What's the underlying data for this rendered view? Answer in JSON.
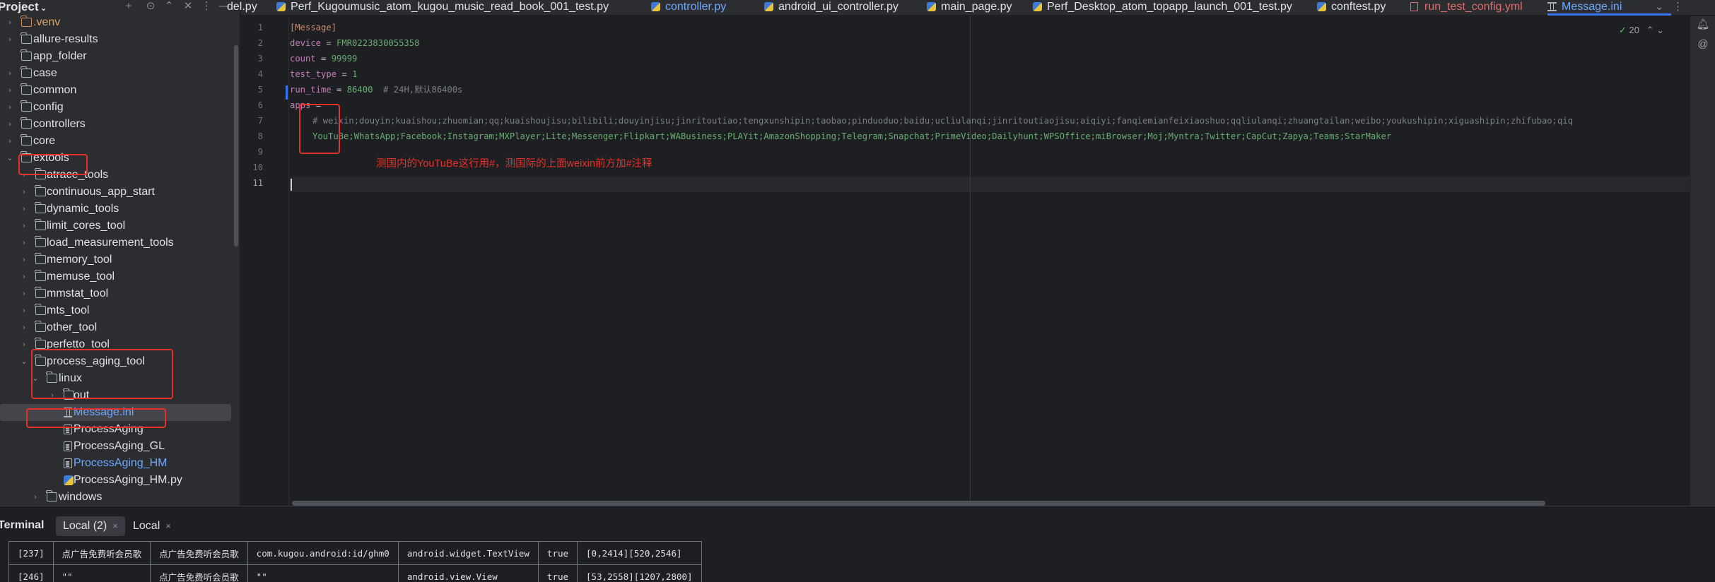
{
  "project": {
    "title": "Project",
    "title_chevron": "⌄",
    "header_icons": [
      "add-icon",
      "target-icon",
      "expand-icon",
      "collapse-icon",
      "more-icon",
      "minimize-icon"
    ],
    "tree": [
      {
        "label": ".venv",
        "icon": "folder",
        "color": "orange",
        "level": 0,
        "arrow": "›"
      },
      {
        "label": "allure-results",
        "icon": "folder",
        "level": 0,
        "arrow": "›"
      },
      {
        "label": "app_folder",
        "icon": "folder",
        "level": 0,
        "arrow": ""
      },
      {
        "label": "case",
        "icon": "folder",
        "level": 0,
        "arrow": "›"
      },
      {
        "label": "common",
        "icon": "folder",
        "level": 0,
        "arrow": "›"
      },
      {
        "label": "config",
        "icon": "folder",
        "level": 0,
        "arrow": "›"
      },
      {
        "label": "controllers",
        "icon": "folder",
        "level": 0,
        "arrow": "›"
      },
      {
        "label": "core",
        "icon": "folder",
        "level": 0,
        "arrow": "›"
      },
      {
        "label": "extools",
        "icon": "folder",
        "level": 0,
        "arrow": "⌄"
      },
      {
        "label": "atrace_tools",
        "icon": "folder",
        "level": 1,
        "arrow": "›"
      },
      {
        "label": "continuous_app_start",
        "icon": "folder",
        "level": 1,
        "arrow": "›"
      },
      {
        "label": "dynamic_tools",
        "icon": "folder",
        "level": 1,
        "arrow": "›"
      },
      {
        "label": "limit_cores_tool",
        "icon": "folder",
        "level": 1,
        "arrow": "›"
      },
      {
        "label": "load_measurement_tools",
        "icon": "folder",
        "level": 1,
        "arrow": "›"
      },
      {
        "label": "memory_tool",
        "icon": "folder",
        "level": 1,
        "arrow": "›"
      },
      {
        "label": "memuse_tool",
        "icon": "folder",
        "level": 1,
        "arrow": "›"
      },
      {
        "label": "mmstat_tool",
        "icon": "folder",
        "level": 1,
        "arrow": "›"
      },
      {
        "label": "mts_tool",
        "icon": "folder",
        "level": 1,
        "arrow": "›"
      },
      {
        "label": "other_tool",
        "icon": "folder",
        "level": 1,
        "arrow": "›"
      },
      {
        "label": "perfetto_tool",
        "icon": "folder",
        "level": 1,
        "arrow": "›"
      },
      {
        "label": "process_aging_tool",
        "icon": "folder",
        "level": 1,
        "arrow": "⌄"
      },
      {
        "label": "linux",
        "icon": "folder",
        "level": 2,
        "arrow": "⌄"
      },
      {
        "label": "out",
        "icon": "folder",
        "level": 3,
        "arrow": "›"
      },
      {
        "label": "Message.ini",
        "icon": "ini",
        "level": 3,
        "arrow": "",
        "color": "blue",
        "selected": true
      },
      {
        "label": "ProcessAging",
        "icon": "file",
        "level": 3,
        "arrow": ""
      },
      {
        "label": "ProcessAging_GL",
        "icon": "file",
        "level": 3,
        "arrow": ""
      },
      {
        "label": "ProcessAging_HM",
        "icon": "file",
        "level": 3,
        "arrow": "",
        "color": "blue"
      },
      {
        "label": "ProcessAging_HM.py",
        "icon": "py",
        "level": 3,
        "arrow": ""
      },
      {
        "label": "windows",
        "icon": "folder",
        "level": 2,
        "arrow": "›"
      }
    ]
  },
  "tabs": [
    {
      "label": "del.py",
      "icon": "py",
      "color": ""
    },
    {
      "label": "Perf_Kugoumusic_atom_kugou_music_read_book_001_test.py",
      "icon": "py",
      "color": ""
    },
    {
      "label": "controller.py",
      "icon": "py",
      "color": "blue"
    },
    {
      "label": "android_ui_controller.py",
      "icon": "py",
      "color": ""
    },
    {
      "label": "main_page.py",
      "icon": "py",
      "color": ""
    },
    {
      "label": "Perf_Desktop_atom_topapp_launch_001_test.py",
      "icon": "py",
      "color": ""
    },
    {
      "label": "conftest.py",
      "icon": "py",
      "color": ""
    },
    {
      "label": "run_test_config.yml",
      "icon": "yml",
      "color": "red"
    },
    {
      "label": "Message.ini",
      "icon": "ini",
      "color": "blue",
      "active": true
    }
  ],
  "tab_controls": {
    "dropdown": "⌄",
    "more": "⋮"
  },
  "editor": {
    "inspection_count": "20",
    "inspection_arrows": "⌃ ⌄",
    "line_numbers": [
      "1",
      "2",
      "3",
      "4",
      "5",
      "6",
      "7",
      "8",
      "9",
      "10",
      "11"
    ],
    "lines": {
      "l1": "[Message]",
      "l2_key": "device",
      "l2_val": "FMR0223830055358",
      "l3_key": "count",
      "l3_val": "99999",
      "l4_key": "test_type",
      "l4_val": "1",
      "l5_key": "run_time",
      "l5_val": "86400",
      "l5_comment": "# 24H,默认86400s",
      "l6_key": "apps",
      "l7": "# weixin;douyin;kuaishou;zhuomian;qq;kuaishoujisu;bilibili;douyinjisu;jinritoutiao;tengxunshipin;taobao;pinduoduo;baidu;ucliulanqi;jinritoutiaojisu;aiqiyi;fanqiemianfeixiaoshuo;qqliulanqi;zhuangtailan;weibo;youkushipin;xiguashipin;zhifubao;qiq",
      "l8": "YouTuBe;WhatsApp;Facebook;Instagram;MXPlayer;Lite;Messenger;Flipkart;WABusiness;PLAYit;AmazonShopping;Telegram;Snapchat;PrimeVideo;Dailyhunt;WPSOffice;miBrowser;Moj;Myntra;Twitter;CapCut;Zapya;Teams;StarMaker"
    },
    "annotation": "测国内的YouTuBe这行用#，测国际的上面weixin前方加#注释"
  },
  "right_strip_icons": [
    "notifications-icon",
    "ai-assistant-icon"
  ],
  "terminal": {
    "title": "Terminal",
    "tabs": [
      {
        "label": "Local (2)",
        "active": true
      },
      {
        "label": "Local",
        "active": false
      }
    ],
    "close_glyph": "×",
    "rows": [
      [
        "[237]",
        "点广告免费听会员歌",
        "点广告免费听会员歌",
        "com.kugou.android:id/ghm0",
        "android.widget.TextView",
        "true",
        "[0,2414][520,2546]"
      ],
      [
        "[246]",
        "\"\"",
        "点广告免费听会员歌",
        "\"\"",
        "android.view.View",
        "true",
        "[53,2558][1207,2800]"
      ]
    ]
  },
  "colors": {
    "accent": "#3574f0",
    "highlight_box": "#e5312c",
    "ini_section": "#cf8e6d",
    "ini_key": "#c77dbb",
    "ini_value": "#6aab73"
  }
}
